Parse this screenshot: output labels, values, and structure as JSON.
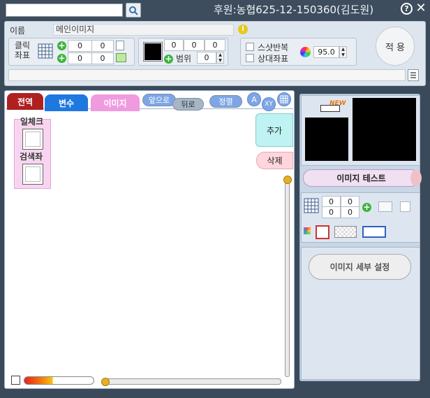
{
  "header": {
    "search_value": "",
    "sponsor": "후원:농협625-12-150360(김도원)",
    "help_icon": "?",
    "close_icon": "✕"
  },
  "settings": {
    "name_label": "이름",
    "name_value": "메인이미지",
    "click_label_1": "클릭",
    "click_label_2": "좌표",
    "click_x1": "0",
    "click_y1": "0",
    "click_x2": "0",
    "click_y2": "0",
    "color_r": "0",
    "color_g": "0",
    "color_b": "0",
    "range_label": "범위",
    "range_value": "0",
    "screenshot_repeat": "스샷반복",
    "relative_coords": "상대좌표",
    "opacity_value": "95.0",
    "apply_label": "적 용",
    "color_swatch": "#000000"
  },
  "tabs": [
    {
      "label": "전역",
      "bg": "#b02020",
      "color": "#ffffff"
    },
    {
      "label": "변수",
      "bg": "#1e78e0",
      "color": "#ffffff"
    },
    {
      "label": "이미지",
      "bg": "#f09ae0",
      "color": "#ffffff"
    }
  ],
  "toolbar": {
    "forward": "앞으로",
    "back": "뒤로",
    "sort": "정렬",
    "a_label": "A",
    "xy_label": "XY"
  },
  "side_buttons": {
    "add": "추가",
    "delete": "삭제"
  },
  "items": [
    {
      "label": "일체크"
    },
    {
      "label": "검색좌"
    }
  ],
  "preview": {
    "new_badge": "NEW",
    "test_label": "이미지 테스트"
  },
  "tools": {
    "grid_a": "0",
    "grid_b": "0",
    "grid_c": "0",
    "grid_d": "0"
  },
  "detail": {
    "label": "이미지 세부 설정"
  }
}
